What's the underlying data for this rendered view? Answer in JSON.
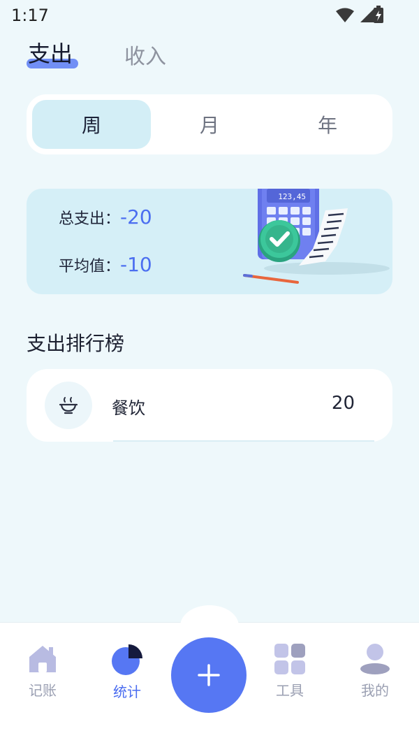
{
  "status_bar": {
    "time": "1:17"
  },
  "header_tabs": {
    "expense": "支出",
    "income": "收入"
  },
  "period": {
    "week": "周",
    "month": "月",
    "year": "年",
    "selected": "周"
  },
  "summary": {
    "total_label": "总支出：",
    "total_value": "-20",
    "average_label": "平均值：",
    "average_value": "-10",
    "calculator_display": "123,45"
  },
  "ranking": {
    "title": "支出排行榜",
    "items": [
      {
        "icon": "bowl-icon",
        "name": "餐饮",
        "amount": "20"
      }
    ]
  },
  "bottom_nav": {
    "items": [
      {
        "label": "记账",
        "icon": "home-icon"
      },
      {
        "label": "统计",
        "icon": "pie-chart-icon",
        "active": true
      },
      {
        "label": "工具",
        "icon": "grid-icon"
      },
      {
        "label": "我的",
        "icon": "user-icon"
      }
    ],
    "add_icon": "plus-icon"
  },
  "colors": {
    "accent": "#5677f3",
    "background": "#eef8fb",
    "card_highlight": "#d5eff7"
  }
}
